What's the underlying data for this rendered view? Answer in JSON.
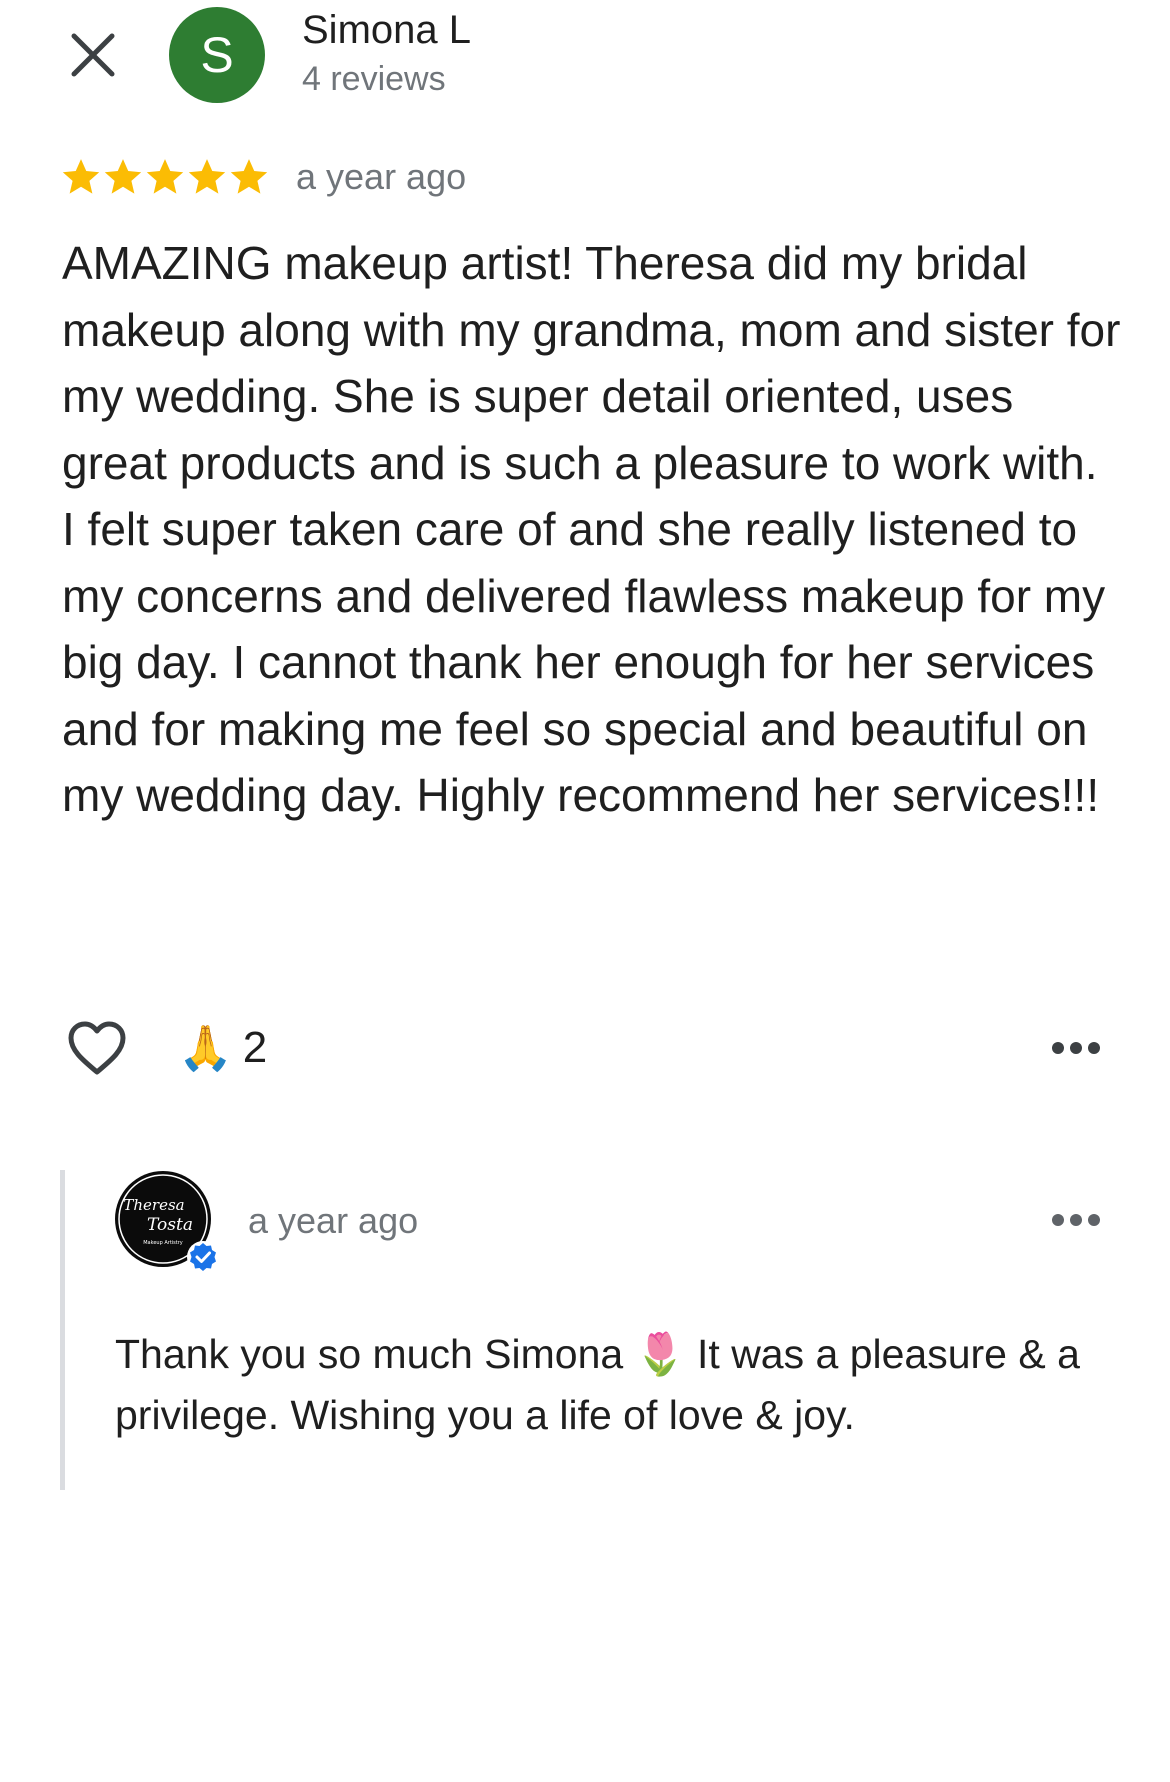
{
  "header": {
    "close_icon": "close-icon",
    "avatar_letter": "S",
    "avatar_color": "#2e7d32",
    "reviewer_name": "Simona L",
    "review_count": "4 reviews"
  },
  "review": {
    "rating": 5,
    "rating_max": 5,
    "star_color": "#fbbc04",
    "time": "a year ago",
    "text": "AMAZING makeup artist! Theresa did my bridal makeup along with my grandma, mom and sister for my wedding. She is super detail oriented, uses great products and is such a pleasure to work with. I felt super taken care of and she really listened to my concerns and delivered flawless makeup for my big day. I cannot thank her enough for her services and for making me feel so special and beautiful on my wedding day. Highly recommend her services!!!",
    "like_icon": "heart-outline-icon",
    "reaction_emoji": "🙏",
    "reaction_count": "2",
    "more_icon": "more-horizontal-icon"
  },
  "owner_reply": {
    "logo_text_line1": "Theresa",
    "logo_text_line2": "Tosta",
    "logo_subtitle": "Makeup Artistry",
    "verified_icon": "verified-badge-icon",
    "time": "a year ago",
    "text": "Thank you so much Simona 🌷 It was a pleasure & a privilege. Wishing you a life of love & joy.",
    "more_icon": "more-horizontal-icon"
  }
}
